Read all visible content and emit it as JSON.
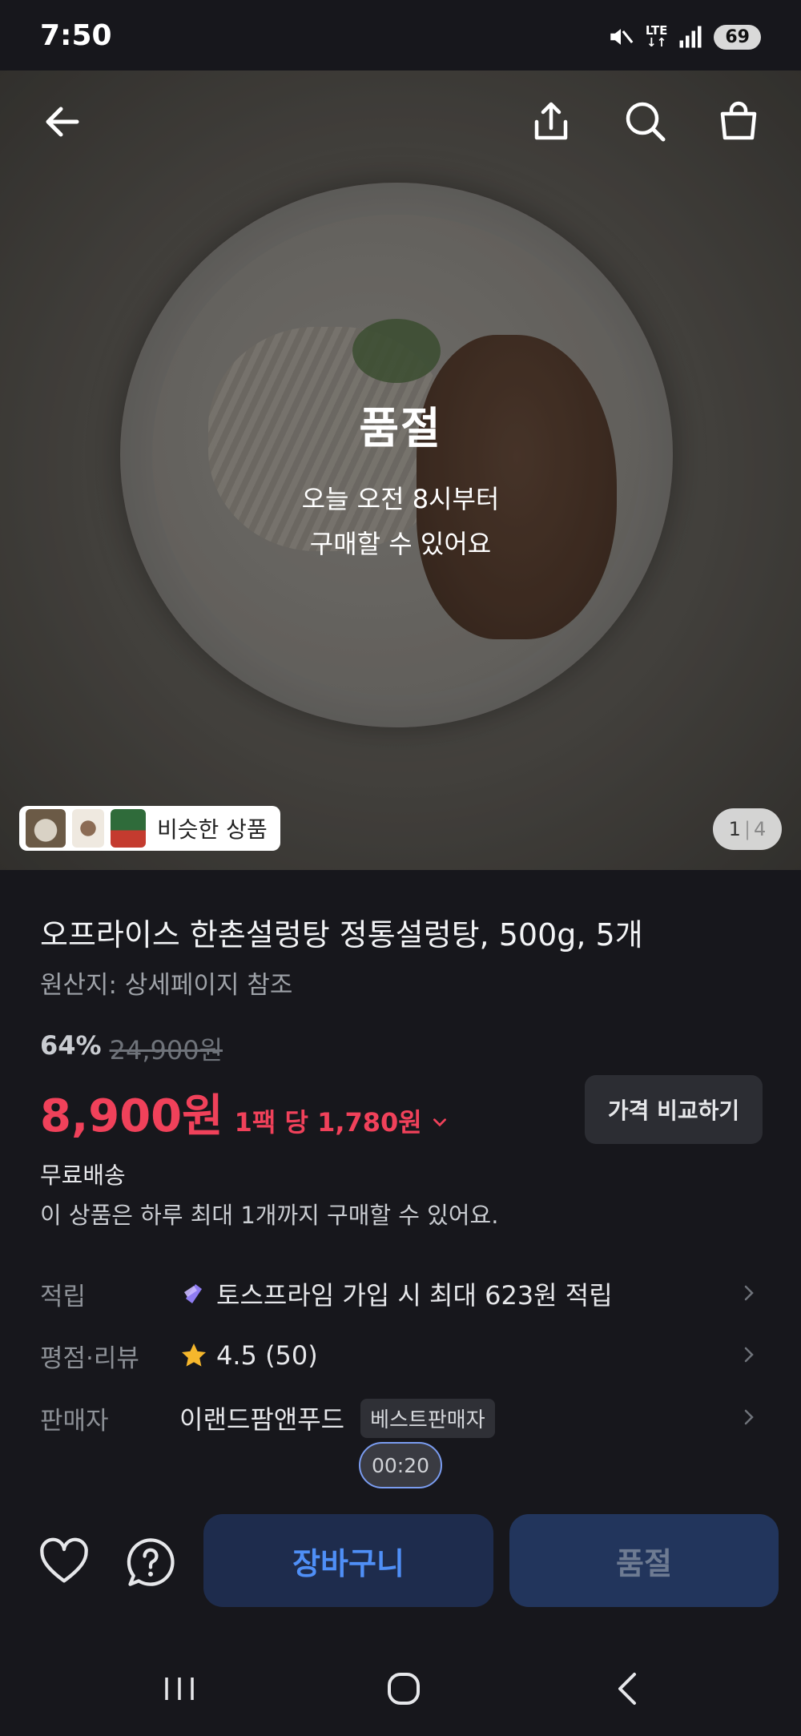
{
  "status_bar": {
    "time": "7:50",
    "network": "LTE",
    "battery": "69"
  },
  "hero": {
    "soldout_title": "품절",
    "soldout_line1": "오늘 오전 8시부터",
    "soldout_line2": "구매할 수 있어요",
    "similar_label": "비슷한 상품",
    "pager_current": "1",
    "pager_total": "4"
  },
  "product": {
    "title": "오프라이스 한촌설렁탕 정통설렁탕, 500g, 5개",
    "origin": "원산지: 상세페이지 참조",
    "discount_rate": "64%",
    "original_price": "24,900원",
    "price": "8,900원",
    "unit_price": "1팩 당 1,780원",
    "compare_label": "가격 비교하기",
    "shipping": "무료배송",
    "limit_notice": "이 상품은 하루 최대 1개까지 구매할 수 있어요."
  },
  "details": {
    "points_label": "적립",
    "points_value": "토스프라임 가입 시 최대 623원 적립",
    "rating_label": "평점·리뷰",
    "rating_value": "4.5 (50)",
    "seller_label": "판매자",
    "seller_value": "이랜드팜앤푸드",
    "seller_badge": "베스트판매자"
  },
  "timer": "00:20",
  "actions": {
    "cart_label": "장바구니",
    "soldout_label": "품절"
  },
  "colors": {
    "price_red": "#f0415a",
    "accent_blue": "#4f8ff7",
    "background": "#17171c"
  }
}
